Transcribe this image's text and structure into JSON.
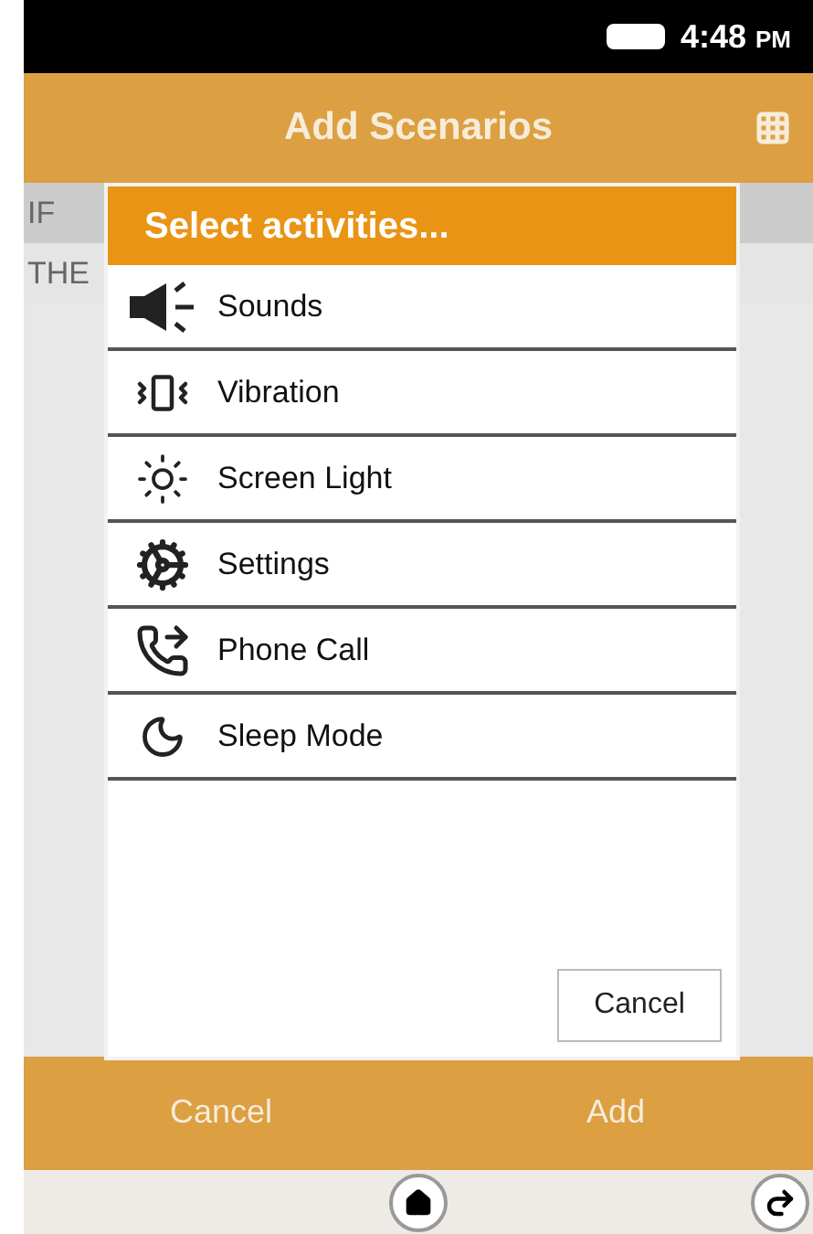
{
  "status_bar": {
    "time": "4:48",
    "period": "PM"
  },
  "header": {
    "title": "Add Scenarios"
  },
  "rows": [
    "IF",
    "THE"
  ],
  "dialog": {
    "title": "Select activities...",
    "items": [
      {
        "kind": "sound",
        "label": "Sounds"
      },
      {
        "kind": "vibration",
        "label": "Vibration"
      },
      {
        "kind": "light",
        "label": "Screen Light"
      },
      {
        "kind": "settings",
        "label": "Settings"
      },
      {
        "kind": "phone",
        "label": "Phone Call"
      },
      {
        "kind": "sleep",
        "label": "Sleep Mode"
      }
    ],
    "cancel": "Cancel"
  },
  "bottom_buttons": [
    "Cancel",
    "Add"
  ]
}
